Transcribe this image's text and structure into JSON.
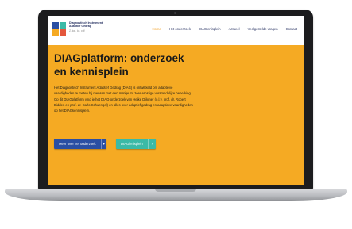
{
  "site": {
    "title_line1": "Diagnostisch Instrument",
    "title_line2": "Adaptief Gedrag",
    "tagline": "Z. toe. lot. pdf"
  },
  "logo_colors": [
    "#2a4fa3",
    "#3bbaa7",
    "#f5aa23",
    "#e4573d"
  ],
  "nav": {
    "items": [
      "Home",
      "Het onderzoek",
      "DIAGlenisplein",
      "Actueel",
      "Veelgestelde vragen",
      "Contact"
    ],
    "active": "Home"
  },
  "hero": {
    "heading": "DIAGplatform: onderzoek en kennisplein",
    "body": "Het Diagnostisch Instrument Adaptief Gedrag (DIAG) is ontwikkeld om adaptieve vaardigheden te meten bij mensen met een matige tot zeer ernstige verstandelijke beperking. Op dit DIAGplatform vind je het DIAG-onderzoek van Heike Dijkmer (o.l.v. prof. dr. Robert Didden en prof. dr. Carlo Schuengel) en alles over adaptief gedrag en adaptieve vaardigheden op het DIAGkennisplein."
  },
  "buttons": {
    "primary": "Meer over het onderzoek",
    "secondary": "DIAGlenisplein"
  },
  "colors": {
    "background": "#f5aa23",
    "brand_blue": "#2a4fa3",
    "teal": "#3bbaa7",
    "active_nav": "#f29d1c"
  }
}
